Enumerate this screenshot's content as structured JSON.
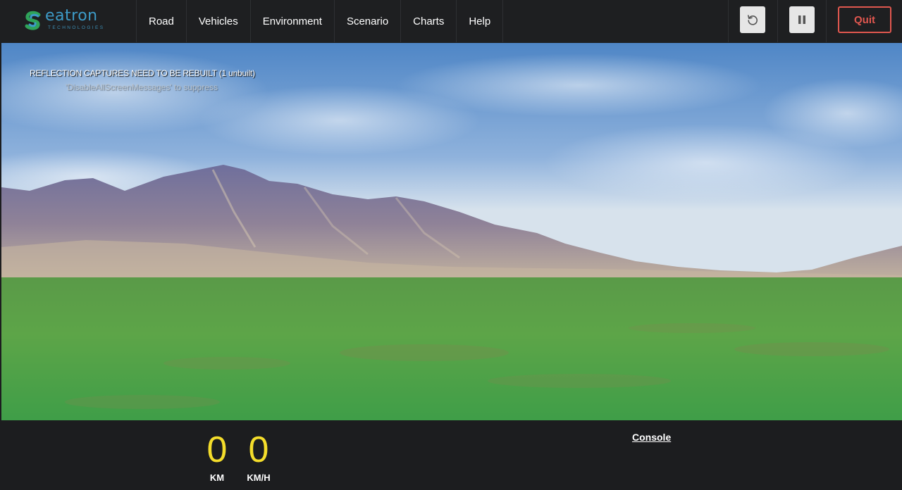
{
  "brand": {
    "name": "eatron",
    "tagline": "TECHNOLOGIES",
    "colors": {
      "primary": "#3d9bc8",
      "accent": "#2fa35a"
    }
  },
  "menu": {
    "items": [
      {
        "label": "Road"
      },
      {
        "label": "Vehicles"
      },
      {
        "label": "Environment"
      },
      {
        "label": "Scenario"
      },
      {
        "label": "Charts"
      },
      {
        "label": "Help"
      }
    ]
  },
  "controls": {
    "reset_icon": "reset-icon",
    "pause_icon": "pause-icon",
    "quit_label": "Quit",
    "quit_color": "#e0574f"
  },
  "viewport": {
    "message_primary": "REFLECTION CAPTURES NEED TO BE REBUILT (1 unbuilt)",
    "message_secondary": "'DisableAllScreenMessages' to suppress"
  },
  "hud": {
    "distance": {
      "value": "0",
      "unit": "KM"
    },
    "speed": {
      "value": "0",
      "unit": "KM/H"
    },
    "value_color": "#f4dd2b",
    "console_label": "Console"
  }
}
